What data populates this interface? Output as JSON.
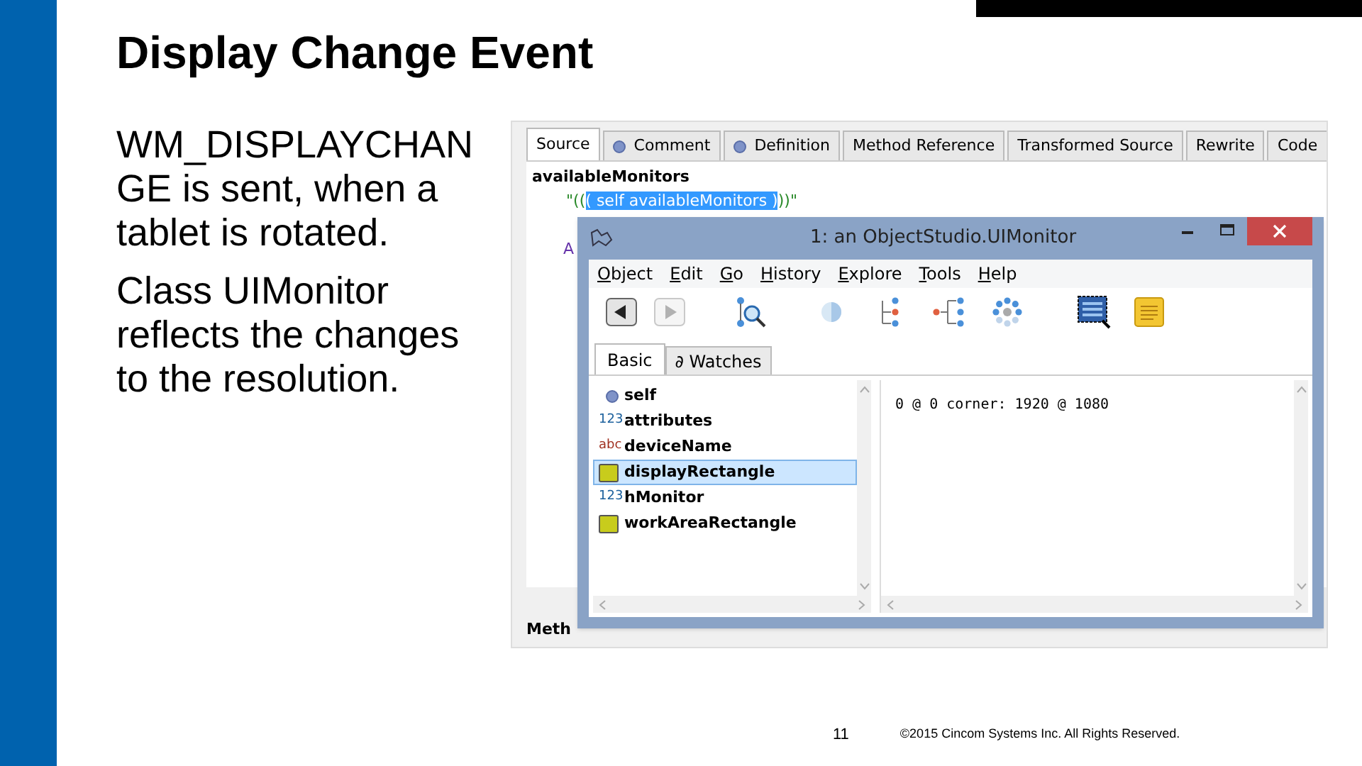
{
  "slide": {
    "title": "Display Change Event",
    "bullets": [
      "WM_DISPLAYCHANGE is sent, when a tablet is rotated.",
      "Class UIMonitor reflects the changes to the resolution."
    ],
    "page_number": "11",
    "copyright": "©2015 Cincom Systems Inc. All Rights Reserved."
  },
  "browser": {
    "tabs": [
      {
        "label": "Source",
        "dot": false,
        "selected": true
      },
      {
        "label": "Comment",
        "dot": true,
        "selected": false
      },
      {
        "label": "Definition",
        "dot": true,
        "selected": false
      },
      {
        "label": "Method Reference",
        "dot": false,
        "selected": false
      },
      {
        "label": "Transformed Source",
        "dot": false,
        "selected": false
      },
      {
        "label": "Rewrite",
        "dot": false,
        "selected": false
      },
      {
        "label": "Code",
        "dot": false,
        "selected": false
      }
    ],
    "method_name": "availableMonitors",
    "code_before": "\"((",
    "code_selected": "( self availableMonitors )",
    "code_after": "))\"",
    "hidden_fragment": "A",
    "bottom_label": "Meth"
  },
  "inspector": {
    "title": "1: an ObjectStudio.UIMonitor",
    "menu": [
      "Object",
      "Edit",
      "Go",
      "History",
      "Explore",
      "Tools",
      "Help"
    ],
    "back_disabled": false,
    "forward_disabled": true,
    "tabs": [
      {
        "label": "Basic",
        "selected": true
      },
      {
        "label": "∂ Watches",
        "selected": false
      }
    ],
    "items": [
      {
        "kind": "dot",
        "name": "self",
        "selected": false
      },
      {
        "kind": "number",
        "badge": "123",
        "name": "attributes",
        "selected": false
      },
      {
        "kind": "text",
        "badge": "abc",
        "name": "deviceName",
        "selected": false
      },
      {
        "kind": "rect",
        "name": "displayRectangle",
        "selected": true
      },
      {
        "kind": "number",
        "badge": "123",
        "name": "hMonitor",
        "selected": false
      },
      {
        "kind": "rect",
        "name": "workAreaRectangle",
        "selected": false
      }
    ],
    "value": "0 @ 0 corner: 1920 @ 1080"
  }
}
